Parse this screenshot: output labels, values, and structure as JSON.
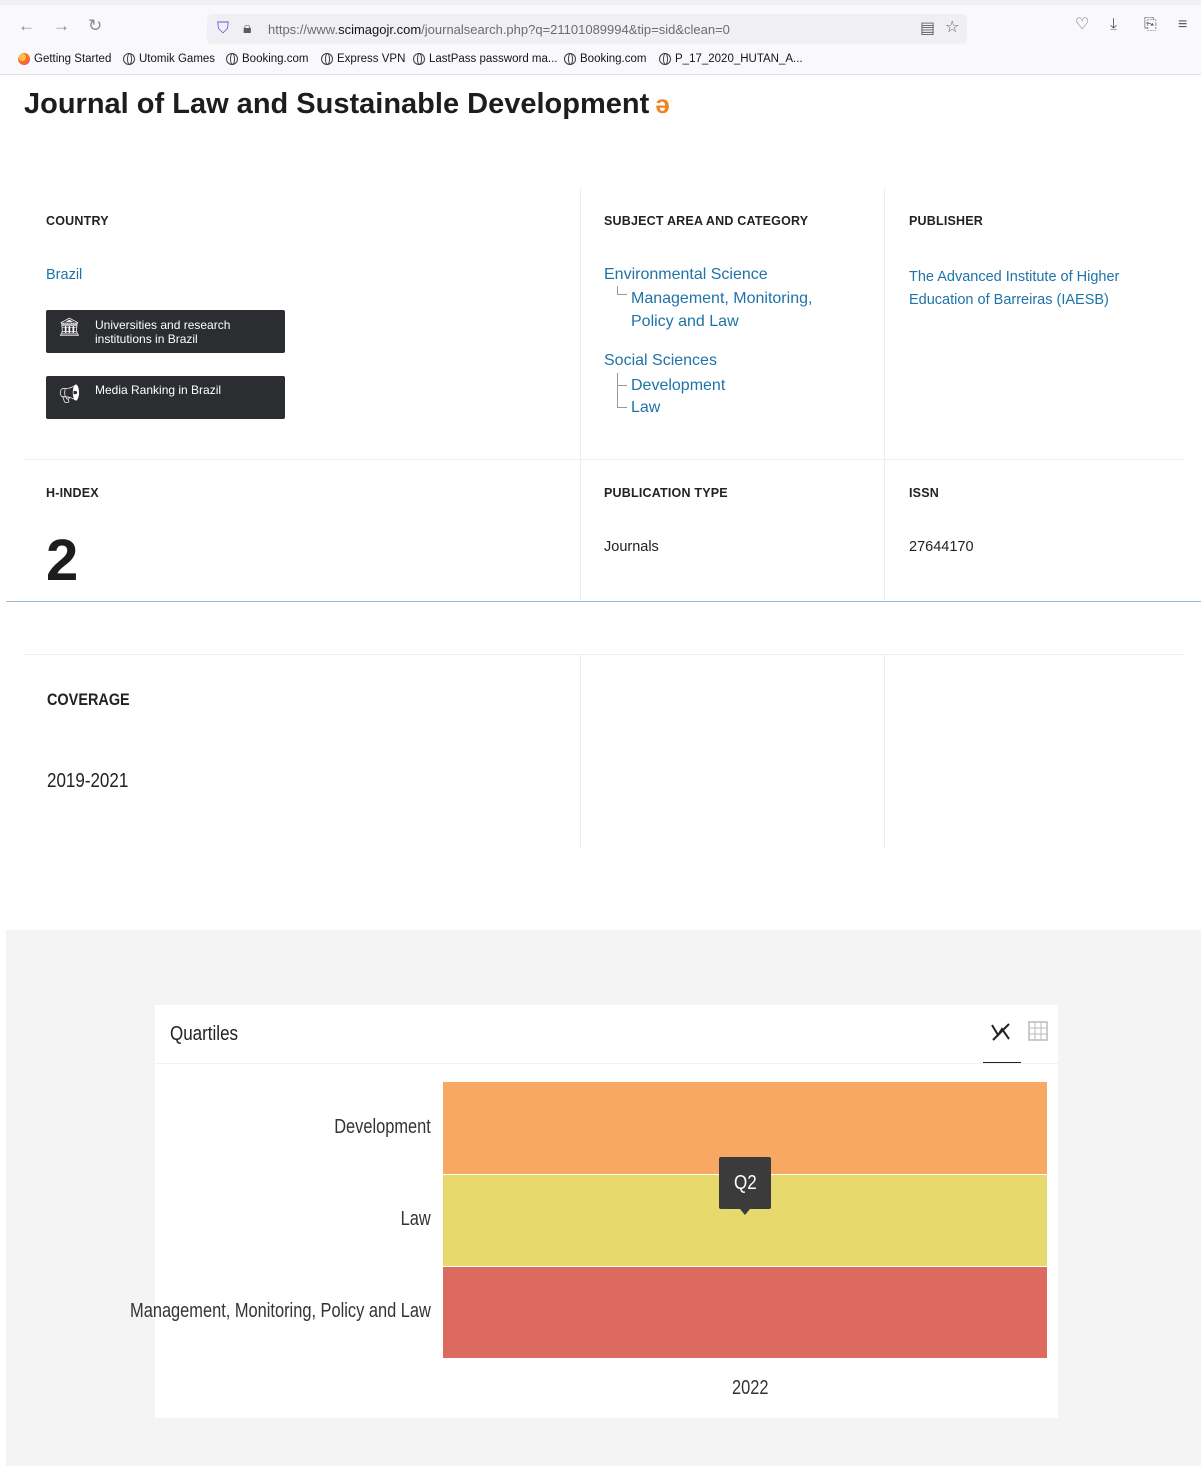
{
  "browser": {
    "url_prefix": "https://www.",
    "url_domain": "scimagojr.com",
    "url_path": "/journalsearch.php?q=21101089994&tip=sid&clean=0",
    "bookmarks": [
      "Getting Started",
      "Utomik Games",
      "Booking.com",
      "Express VPN",
      "LastPass password ma...",
      "Booking.com",
      "P_17_2020_HUTAN_A..."
    ]
  },
  "journal": {
    "title": "Journal of Law and Sustainable Development"
  },
  "country": {
    "label": "COUNTRY",
    "value": "Brazil",
    "btn_universities": "Universities and research institutions in Brazil",
    "btn_media": "Media Ranking in Brazil"
  },
  "subject": {
    "label": "SUBJECT AREA AND CATEGORY",
    "areas": [
      {
        "name": "Environmental Science",
        "categories": [
          "Management, Monitoring, Policy and Law"
        ]
      },
      {
        "name": "Social Sciences",
        "categories": [
          "Development",
          "Law"
        ]
      }
    ],
    "cat_line1": "Management, Monitoring,",
    "cat_line2": "Policy and Law"
  },
  "publisher": {
    "label": "PUBLISHER",
    "value": "The Advanced Institute of Higher Education of Barreiras (IAESB)",
    "line1": "The Advanced Institute of Higher",
    "line2": "Education of Barreiras (IAESB)"
  },
  "hindex": {
    "label": "H-INDEX",
    "value": "2"
  },
  "pubtype": {
    "label": "PUBLICATION TYPE",
    "value": "Journals"
  },
  "issn": {
    "label": "ISSN",
    "value": "27644170"
  },
  "coverage": {
    "label": "COVERAGE",
    "value": "2019-2021"
  },
  "quartiles": {
    "title": "Quartiles",
    "tooltip": "Q2",
    "colors": {
      "Q1": "#a4cf63",
      "Q2": "#e8d96c",
      "Q3": "#f7a963",
      "Q4": "#dd6a5e"
    }
  },
  "chart_data": {
    "type": "heatmap",
    "title": "Quartiles",
    "x": [
      "2022"
    ],
    "rows": [
      "Development",
      "Law",
      "Management, Monitoring, Policy and Law"
    ],
    "values": [
      [
        "Q3"
      ],
      [
        "Q2"
      ],
      [
        "Q4"
      ]
    ]
  }
}
